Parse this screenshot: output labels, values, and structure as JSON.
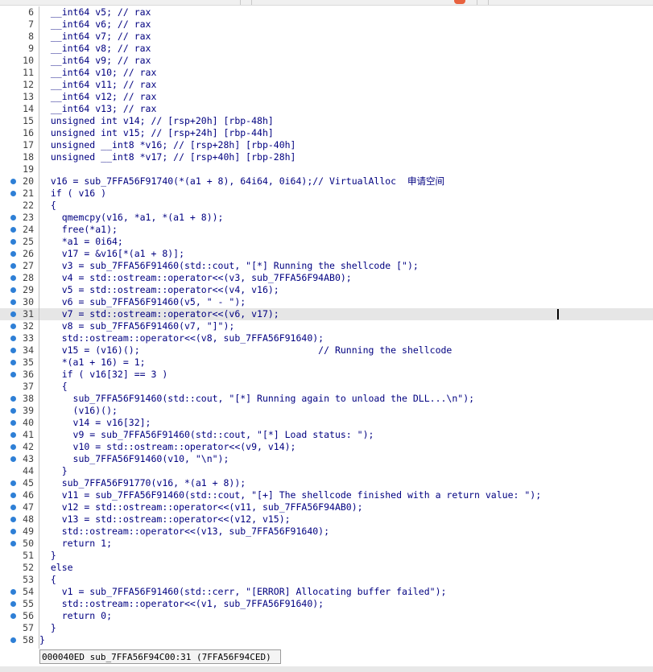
{
  "editor": {
    "lines": [
      {
        "n": "6",
        "text": "  __int64 v5; // rax",
        "bp": false
      },
      {
        "n": "7",
        "text": "  __int64 v6; // rax",
        "bp": false
      },
      {
        "n": "8",
        "text": "  __int64 v7; // rax",
        "bp": false
      },
      {
        "n": "9",
        "text": "  __int64 v8; // rax",
        "bp": false
      },
      {
        "n": "10",
        "text": "  __int64 v9; // rax",
        "bp": false
      },
      {
        "n": "11",
        "text": "  __int64 v10; // rax",
        "bp": false
      },
      {
        "n": "12",
        "text": "  __int64 v11; // rax",
        "bp": false
      },
      {
        "n": "13",
        "text": "  __int64 v12; // rax",
        "bp": false
      },
      {
        "n": "14",
        "text": "  __int64 v13; // rax",
        "bp": false
      },
      {
        "n": "15",
        "text": "  unsigned int v14; // [rsp+20h] [rbp-48h]",
        "bp": false
      },
      {
        "n": "16",
        "text": "  unsigned int v15; // [rsp+24h] [rbp-44h]",
        "bp": false
      },
      {
        "n": "17",
        "text": "  unsigned __int8 *v16; // [rsp+28h] [rbp-40h]",
        "bp": false
      },
      {
        "n": "18",
        "text": "  unsigned __int8 *v17; // [rsp+40h] [rbp-28h]",
        "bp": false
      },
      {
        "n": "19",
        "text": "",
        "bp": false
      },
      {
        "n": "20",
        "text": "  v16 = sub_7FFA56F91740(*(a1 + 8), 64i64, 0i64);// VirtualAlloc  申请空间",
        "bp": true
      },
      {
        "n": "21",
        "text": "  if ( v16 )",
        "bp": true
      },
      {
        "n": "22",
        "text": "  {",
        "bp": false
      },
      {
        "n": "23",
        "text": "    qmemcpy(v16, *a1, *(a1 + 8));",
        "bp": true
      },
      {
        "n": "24",
        "text": "    free(*a1);",
        "bp": true
      },
      {
        "n": "25",
        "text": "    *a1 = 0i64;",
        "bp": true
      },
      {
        "n": "26",
        "text": "    v17 = &v16[*(a1 + 8)];",
        "bp": true
      },
      {
        "n": "27",
        "text": "    v3 = sub_7FFA56F91460(std::cout, \"[*] Running the shellcode [\");",
        "bp": true
      },
      {
        "n": "28",
        "text": "    v4 = std::ostream::operator<<(v3, sub_7FFA56F94AB0);",
        "bp": true
      },
      {
        "n": "29",
        "text": "    v5 = std::ostream::operator<<(v4, v16);",
        "bp": true
      },
      {
        "n": "30",
        "text": "    v6 = sub_7FFA56F91460(v5, \" - \");",
        "bp": true
      },
      {
        "n": "31",
        "text": "    v7 = std::ostream::operator<<(v6, v17);",
        "bp": true
      },
      {
        "n": "32",
        "text": "    v8 = sub_7FFA56F91460(v7, \"]\");",
        "bp": true
      },
      {
        "n": "33",
        "text": "    std::ostream::operator<<(v8, sub_7FFA56F91640);",
        "bp": true
      },
      {
        "n": "34",
        "text": "    v15 = (v16)();                                // Running the shellcode",
        "bp": true
      },
      {
        "n": "35",
        "text": "    *(a1 + 16) = 1;",
        "bp": true
      },
      {
        "n": "36",
        "text": "    if ( v16[32] == 3 )",
        "bp": true
      },
      {
        "n": "37",
        "text": "    {",
        "bp": false
      },
      {
        "n": "38",
        "text": "      sub_7FFA56F91460(std::cout, \"[*] Running again to unload the DLL...\\n\");",
        "bp": true
      },
      {
        "n": "39",
        "text": "      (v16)();",
        "bp": true
      },
      {
        "n": "40",
        "text": "      v14 = v16[32];",
        "bp": true
      },
      {
        "n": "41",
        "text": "      v9 = sub_7FFA56F91460(std::cout, \"[*] Load status: \");",
        "bp": true
      },
      {
        "n": "42",
        "text": "      v10 = std::ostream::operator<<(v9, v14);",
        "bp": true
      },
      {
        "n": "43",
        "text": "      sub_7FFA56F91460(v10, \"\\n\");",
        "bp": true
      },
      {
        "n": "44",
        "text": "    }",
        "bp": false
      },
      {
        "n": "45",
        "text": "    sub_7FFA56F91770(v16, *(a1 + 8));",
        "bp": true
      },
      {
        "n": "46",
        "text": "    v11 = sub_7FFA56F91460(std::cout, \"[+] The shellcode finished with a return value: \");",
        "bp": true
      },
      {
        "n": "47",
        "text": "    v12 = std::ostream::operator<<(v11, sub_7FFA56F94AB0);",
        "bp": true
      },
      {
        "n": "48",
        "text": "    v13 = std::ostream::operator<<(v12, v15);",
        "bp": true
      },
      {
        "n": "49",
        "text": "    std::ostream::operator<<(v13, sub_7FFA56F91640);",
        "bp": true
      },
      {
        "n": "50",
        "text": "    return 1;",
        "bp": true
      },
      {
        "n": "51",
        "text": "  }",
        "bp": false
      },
      {
        "n": "52",
        "text": "  else",
        "bp": false
      },
      {
        "n": "53",
        "text": "  {",
        "bp": false
      },
      {
        "n": "54",
        "text": "    v1 = sub_7FFA56F91460(std::cerr, \"[ERROR] Allocating buffer failed\");",
        "bp": true
      },
      {
        "n": "55",
        "text": "    std::ostream::operator<<(v1, sub_7FFA56F91640);",
        "bp": true
      },
      {
        "n": "56",
        "text": "    return 0;",
        "bp": true
      },
      {
        "n": "57",
        "text": "  }",
        "bp": false
      },
      {
        "n": "58",
        "text": "}",
        "bp": true
      }
    ],
    "highlighted_line": "31"
  },
  "status": {
    "text": "000040ED sub_7FFA56F94C00:31 (7FFA56F94CED)"
  },
  "colors": {
    "code_text": "#000080",
    "breakpoint_dot": "#2e7fd6",
    "line_highlight": "#e6e6e6"
  }
}
